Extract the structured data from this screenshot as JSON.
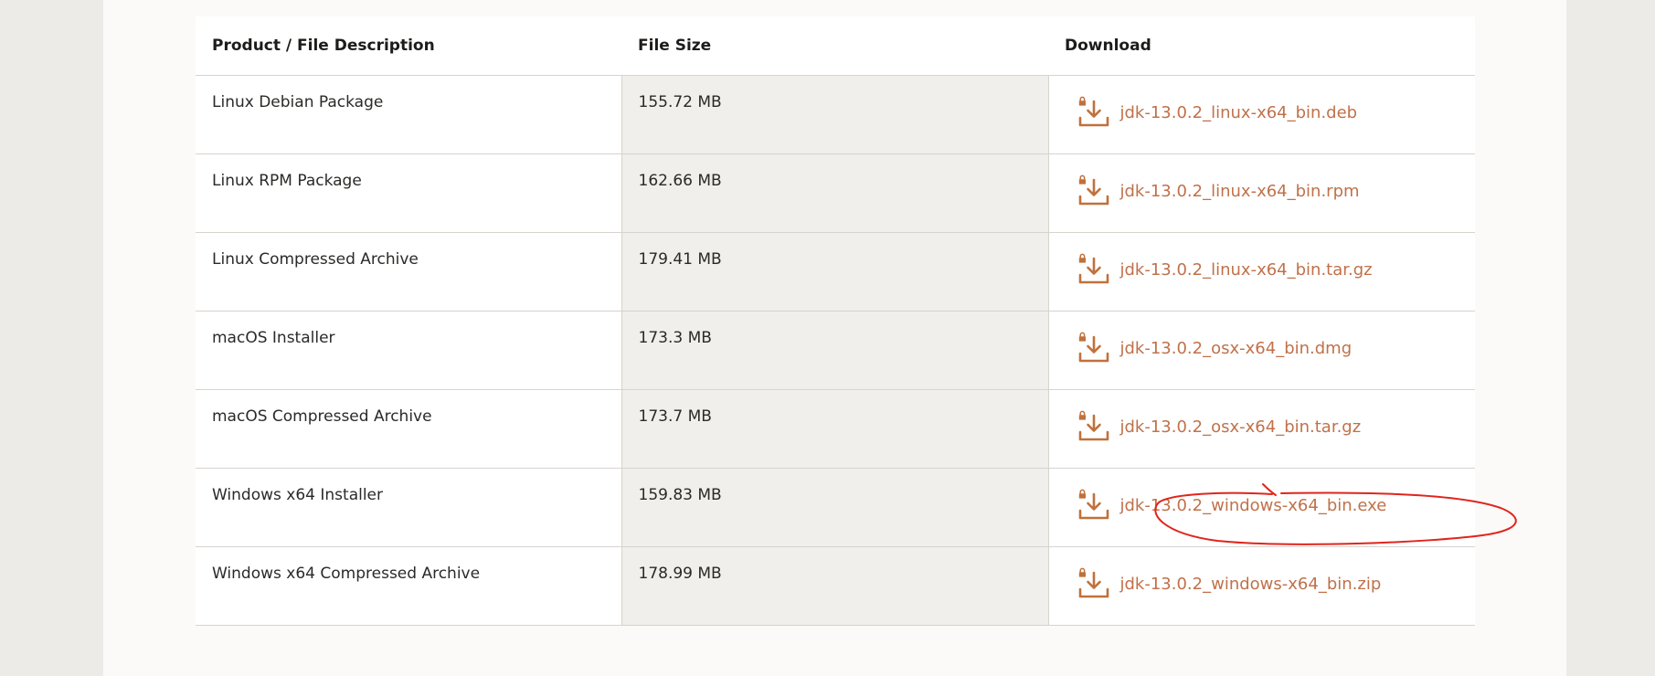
{
  "table": {
    "headers": {
      "description": "Product / File Description",
      "size": "File Size",
      "download": "Download"
    },
    "rows": [
      {
        "description": "Linux Debian Package",
        "size": "155.72 MB",
        "file": "jdk-13.0.2_linux-x64_bin.deb"
      },
      {
        "description": "Linux RPM Package",
        "size": "162.66 MB",
        "file": "jdk-13.0.2_linux-x64_bin.rpm"
      },
      {
        "description": "Linux Compressed Archive",
        "size": "179.41 MB",
        "file": "jdk-13.0.2_linux-x64_bin.tar.gz"
      },
      {
        "description": "macOS Installer",
        "size": "173.3 MB",
        "file": "jdk-13.0.2_osx-x64_bin.dmg"
      },
      {
        "description": "macOS Compressed Archive",
        "size": "173.7 MB",
        "file": "jdk-13.0.2_osx-x64_bin.tar.gz"
      },
      {
        "description": "Windows x64 Installer",
        "size": "159.83 MB",
        "file": "jdk-13.0.2_windows-x64_bin.exe"
      },
      {
        "description": "Windows x64 Compressed Archive",
        "size": "178.99 MB",
        "file": "jdk-13.0.2_windows-x64_bin.zip"
      }
    ]
  },
  "icons": {
    "download": "download-icon",
    "lock": "lock-icon"
  },
  "colors": {
    "link": "#c0714a",
    "icon": "#c0713b",
    "annotation": "#e0251c",
    "size_column_bg": "#f1efeb"
  }
}
